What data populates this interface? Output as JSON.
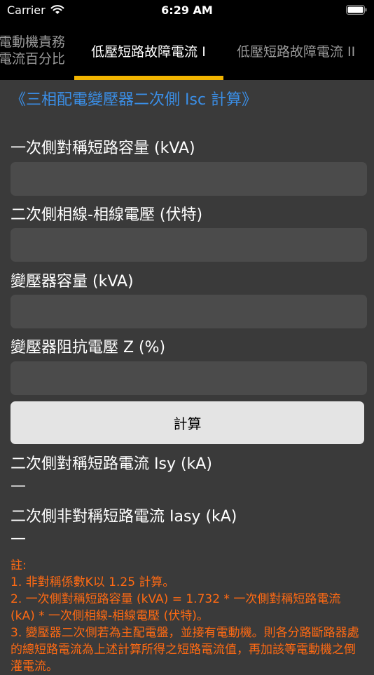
{
  "status_bar": {
    "carrier": "Carrier",
    "time": "6:29 AM"
  },
  "tabs": [
    {
      "label_line1": "電動機責務",
      "label_line2": "電流百分比"
    },
    {
      "label": "低壓短路故障電流 I"
    },
    {
      "label": "低壓短路故障電流 II"
    }
  ],
  "heading": "《三相配電變壓器二次側 Isc 計算》",
  "fields": [
    {
      "label": "一次側對稱短路容量 (kVA)",
      "value": ""
    },
    {
      "label": "二次側相線-相線電壓 (伏特)",
      "value": ""
    },
    {
      "label": "變壓器容量 (kVA)",
      "value": ""
    },
    {
      "label": "變壓器阻抗電壓 Z (%)",
      "value": ""
    }
  ],
  "calculate_label": "計算",
  "results": [
    {
      "label": "二次側對稱短路電流 Isy (kA)",
      "value": "—"
    },
    {
      "label": "二次側非對稱短路電流 Iasy (kA)",
      "value": "—"
    }
  ],
  "notes": [
    "註:",
    "1. 非對稱係數K以 1.25 計算。",
    "2. 一次側對稱短路容量 (kVA) = 1.732 * 一次側對稱短路電流 (kA) * 一次側相線-相線電壓 (伏特)。",
    "3. 變壓器二次側若為主配電盤，並接有電動機。則各分路斷路器處的總短路電流為上述計算所得之短路電流值，再加該等電動機之倒灌電流。"
  ],
  "colors": {
    "accent": "#f2b400",
    "heading": "#3a8ee6",
    "note": "#ff6a13"
  }
}
